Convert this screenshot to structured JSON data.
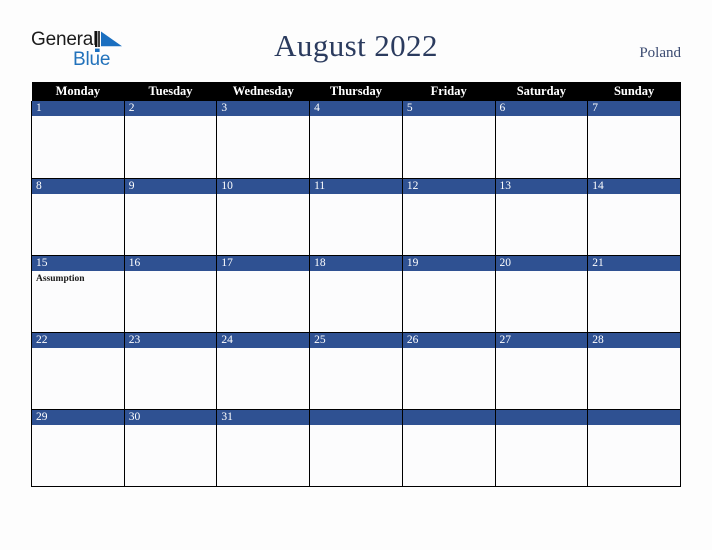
{
  "brand": {
    "word_one": "General",
    "word_two": "Blue",
    "mark_icon": "triangle-logo-icon",
    "color_black": "#1b1b1b",
    "color_blue": "#2272bb"
  },
  "header": {
    "title": "August 2022",
    "country": "Poland"
  },
  "calendar": {
    "accent_blue": "#2f5192",
    "header_background": "#000000",
    "cell_background": "#fcfcfd",
    "weekday_headers": [
      "Monday",
      "Tuesday",
      "Wednesday",
      "Thursday",
      "Friday",
      "Saturday",
      "Sunday"
    ],
    "weeks": [
      [
        {
          "day": "1",
          "event": ""
        },
        {
          "day": "2",
          "event": ""
        },
        {
          "day": "3",
          "event": ""
        },
        {
          "day": "4",
          "event": ""
        },
        {
          "day": "5",
          "event": ""
        },
        {
          "day": "6",
          "event": ""
        },
        {
          "day": "7",
          "event": ""
        }
      ],
      [
        {
          "day": "8",
          "event": ""
        },
        {
          "day": "9",
          "event": ""
        },
        {
          "day": "10",
          "event": ""
        },
        {
          "day": "11",
          "event": ""
        },
        {
          "day": "12",
          "event": ""
        },
        {
          "day": "13",
          "event": ""
        },
        {
          "day": "14",
          "event": ""
        }
      ],
      [
        {
          "day": "15",
          "event": "Assumption"
        },
        {
          "day": "16",
          "event": ""
        },
        {
          "day": "17",
          "event": ""
        },
        {
          "day": "18",
          "event": ""
        },
        {
          "day": "19",
          "event": ""
        },
        {
          "day": "20",
          "event": ""
        },
        {
          "day": "21",
          "event": ""
        }
      ],
      [
        {
          "day": "22",
          "event": ""
        },
        {
          "day": "23",
          "event": ""
        },
        {
          "day": "24",
          "event": ""
        },
        {
          "day": "25",
          "event": ""
        },
        {
          "day": "26",
          "event": ""
        },
        {
          "day": "27",
          "event": ""
        },
        {
          "day": "28",
          "event": ""
        }
      ],
      [
        {
          "day": "29",
          "event": ""
        },
        {
          "day": "30",
          "event": ""
        },
        {
          "day": "31",
          "event": ""
        },
        {
          "day": "",
          "event": ""
        },
        {
          "day": "",
          "event": ""
        },
        {
          "day": "",
          "event": ""
        },
        {
          "day": "",
          "event": ""
        }
      ]
    ]
  }
}
